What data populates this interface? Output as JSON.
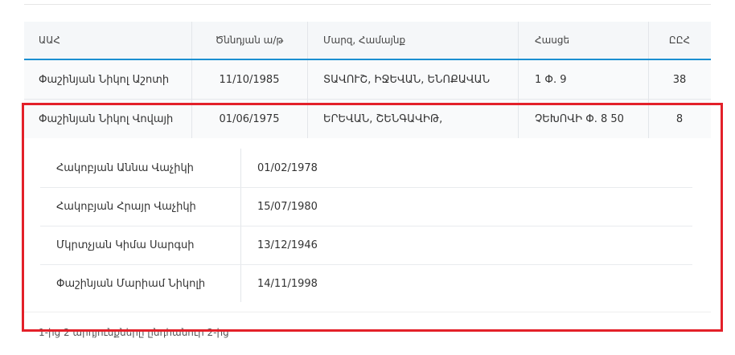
{
  "table": {
    "headers": [
      "ԱԱՀ",
      "Ծննդյան ա/թ",
      "Մարզ, Համայնք",
      "Հասցե",
      "ԸԸՀ"
    ],
    "rows": [
      {
        "name": "Փաշինյան Նիկոլ Աշոտի",
        "birth": "11/10/1985",
        "region": "ՏԱՎՈՒՇ, ԻՋԵՎԱՆ, ԵՆՈՔԱՎԱՆ",
        "address": "1 Փ. 9",
        "precinct": "38"
      },
      {
        "name": "Փաշինյան Նիկոլ Վովայի",
        "birth": "01/06/1975",
        "region": "ԵՐԵՎԱՆ, ՇԵՆԳԱՎԻԹ,",
        "address": "ՉԵԽՈՎԻ Փ. 8 50",
        "precinct": "8"
      }
    ]
  },
  "detail": {
    "rows": [
      {
        "name": "Հակոբյան Աննա Վաչիկի",
        "date": "01/02/1978"
      },
      {
        "name": "Հակոբյան Հրայր Վաչիկի",
        "date": "15/07/1980"
      },
      {
        "name": "Մկրտչյան Կիմա Սարգսի",
        "date": "13/12/1946"
      },
      {
        "name": "Փաշինյան Մարիամ Նիկոլի",
        "date": "14/11/1998"
      }
    ]
  },
  "footer": {
    "text": "1-ից 2 արդյունքները ընդհանուր 2-ից"
  },
  "colors": {
    "accent": "#1b8fd1",
    "link": "#2a7ab8",
    "highlight": "#e32029"
  }
}
